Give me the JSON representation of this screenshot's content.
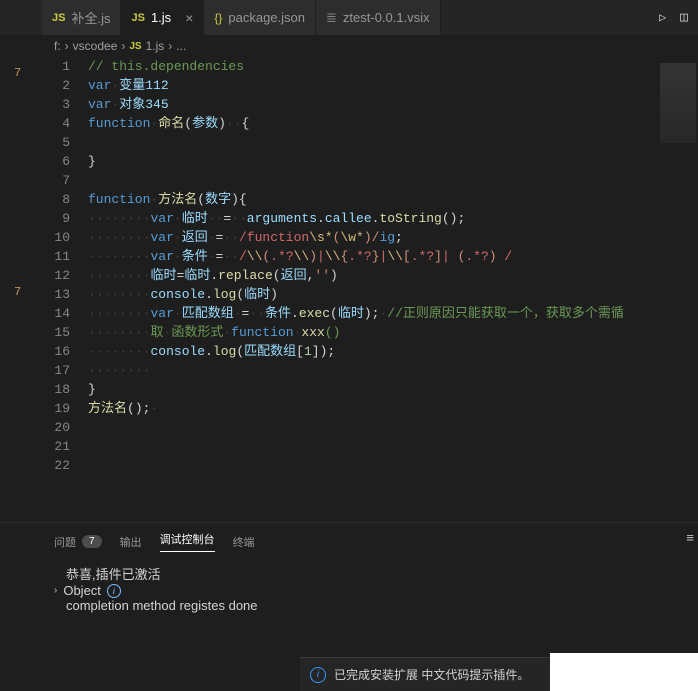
{
  "tabs": [
    {
      "icon": "JS",
      "label": "补全.js",
      "active": false,
      "closable": false
    },
    {
      "icon": "JS",
      "label": "1.js",
      "active": true,
      "closable": true
    },
    {
      "icon": "{}",
      "label": "package.json",
      "active": false,
      "closable": false
    },
    {
      "icon": "≣",
      "label": "ztest-0.0.1.vsix",
      "active": false,
      "closable": false
    }
  ],
  "breadcrumb": {
    "root": "f:",
    "folder": "vscodee",
    "fileIcon": "JS",
    "file": "1.js",
    "tail": "..."
  },
  "margin_marks": [
    {
      "line": 1,
      "text": "7"
    },
    {
      "line": 13,
      "text": "7"
    }
  ],
  "line_numbers": [
    1,
    2,
    3,
    4,
    5,
    6,
    7,
    8,
    9,
    10,
    11,
    12,
    13,
    14,
    "",
    15,
    16,
    17,
    18,
    19,
    20,
    21,
    22
  ],
  "code": {
    "l1": "// this.dependencies",
    "l2_kw": "var",
    "l2_var": "变量112",
    "l3_kw": "var",
    "l3_var": "对象345",
    "l4_kw": "function",
    "l4_fn": "命名",
    "l4_param": "参数",
    "l8_kw": "function",
    "l8_fn": "方法名",
    "l8_param": "数字",
    "l9_kw": "var",
    "l9_var": "临时",
    "l9_arg": "arguments",
    "l9_callee": "callee",
    "l9_ts": "toString",
    "l10_kw": "var",
    "l10_var": "返回",
    "l10_regex_a": "/function",
    "l10_regex_b": "\\s*",
    "l10_regex_c": "(",
    "l10_regex_d": "\\w*",
    "l10_regex_e": ")/",
    "l10_flag": "ig",
    "l11_kw": "var",
    "l11_var": "条件",
    "l11_regex": "/\\\\(.*?\\\\)|\\\\{.*?}|\\\\[.*?]| (.*?) /",
    "l12_a": "临时",
    "l12_b": "临时",
    "l12_fn": "replace",
    "l12_arg1": "返回",
    "l12_arg2": "''",
    "l13_console": "console",
    "l13_log": "log",
    "l13_arg": "临时",
    "l14_kw": "var",
    "l14_var": "匹配数组",
    "l14_a": "条件",
    "l14_fn": "exec",
    "l14_arg": "临时",
    "l14_comment": "//正则原因只能获取一个，获取多个需循",
    "l14b_comment_a": "取",
    "l14b_comment_b": "函数形式",
    "l14b_kw": "function",
    "l14b_fn": "xxx",
    "l14b_tail": "()",
    "l15_console": "console",
    "l15_log": "log",
    "l15_arg": "匹配数组",
    "l15_idx": "1",
    "l18_fn": "方法名"
  },
  "panel": {
    "tabs": {
      "problems": "问题",
      "problems_count": "7",
      "output": "输出",
      "debug": "调试控制台",
      "terminal": "终端"
    },
    "lines": {
      "l1": "恭喜,插件已激活",
      "l2": "Object",
      "l3": "completion method registes done"
    }
  },
  "toast": "已完成安装扩展 中文代码提示插件。"
}
